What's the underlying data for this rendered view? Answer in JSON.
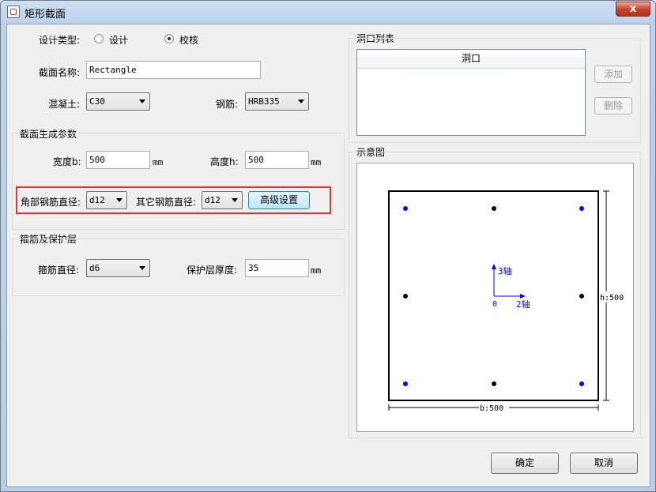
{
  "window": {
    "title": "矩形截面",
    "close_label": "x"
  },
  "design_type": {
    "label": "设计类型:",
    "options": [
      "设计",
      "校核"
    ],
    "selected": "校核"
  },
  "section_name": {
    "label": "截面名称:",
    "value": "Rectangle"
  },
  "concrete": {
    "label": "混凝土:",
    "value": "C30"
  },
  "rebar": {
    "label": "钢筋:",
    "value": "HRB335"
  },
  "gen_params": {
    "title": "截面生成参数",
    "width_label": "宽度b:",
    "width_value": "500",
    "width_unit": "mm",
    "height_label": "高度h:",
    "height_value": "500",
    "height_unit": "mm",
    "corner_label": "角部钢筋直径:",
    "corner_value": "d12",
    "other_label": "其它钢筋直径:",
    "other_value": "d12",
    "advanced_label": "高级设置"
  },
  "stirrup": {
    "title": "箍筋及保护层",
    "diameter_label": "箍筋直径:",
    "diameter_value": "d6",
    "cover_label": "保护层厚度:",
    "cover_value": "35",
    "cover_unit": "mm"
  },
  "openings": {
    "title": "洞口列表",
    "column": "洞口",
    "add_label": "添加",
    "delete_label": "删除"
  },
  "diagram": {
    "title": "示意图",
    "axis3_label": "3轴",
    "axis2_label": "2轴",
    "origin_label": "0",
    "h_label": "h:500",
    "b_label": "b:500",
    "corner_color": "#0000ee",
    "other_color": "#000000"
  },
  "footer": {
    "ok_label": "确定",
    "cancel_label": "取消"
  }
}
